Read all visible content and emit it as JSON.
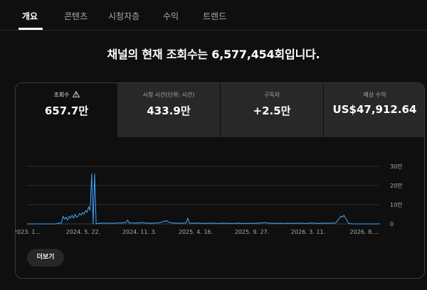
{
  "tabs": [
    {
      "label": "개요",
      "active": true
    },
    {
      "label": "콘텐츠",
      "active": false
    },
    {
      "label": "시청자층",
      "active": false
    },
    {
      "label": "수익",
      "active": false
    },
    {
      "label": "트렌드",
      "active": false
    }
  ],
  "headline": "채널의 현재 조회수는 6,577,454회입니다.",
  "metrics": [
    {
      "label": "조회수",
      "value": "657.7만",
      "icon": "warning-icon",
      "selected": true
    },
    {
      "label": "시청 시간(단위: 시간)",
      "value": "433.9만",
      "selected": false
    },
    {
      "label": "구독자",
      "value": "+2.5만",
      "selected": false
    },
    {
      "label": "예상 수익",
      "value": "US$47,912.64",
      "selected": false
    }
  ],
  "more_button": "더보기",
  "colors": {
    "line": "#3ea6ff",
    "selected_metric_bg": "#0f0f0f",
    "metric_bg": "#282828"
  },
  "chart_data": {
    "type": "line",
    "x_tick_labels": [
      "2023. 1...",
      "2024. 5. 22.",
      "2024. 11. 3.",
      "2025. 4. 16.",
      "2025. 9. 27.",
      "2026. 3. 11.",
      "2026. 8...."
    ],
    "y_tick_labels": [
      "30만",
      "20만",
      "10만",
      "0"
    ],
    "y_ticks": [
      300000,
      200000,
      100000,
      0
    ],
    "ylim": [
      0,
      300000
    ],
    "grid": true,
    "series": [
      {
        "values": [
          0,
          0,
          0,
          0,
          0,
          0,
          0,
          0,
          0,
          0,
          0,
          0,
          0,
          0,
          0,
          0,
          0,
          0,
          0,
          0,
          2000,
          4000,
          3000,
          6000,
          40000,
          25000,
          35000,
          20000,
          40000,
          30000,
          45000,
          30000,
          50000,
          35000,
          40000,
          55000,
          45000,
          60000,
          50000,
          70000,
          60000,
          90000,
          70000,
          260000,
          0,
          260000,
          0,
          3000,
          2000,
          4000,
          3000,
          5000,
          4000,
          3000,
          4000,
          5000,
          3000,
          4000,
          3000,
          5000,
          4000,
          5000,
          6000,
          5000,
          7000,
          6000,
          8000,
          20000,
          5000,
          6000,
          5000,
          4000,
          5000,
          4000,
          6000,
          5000,
          7000,
          6000,
          5000,
          4000,
          5000,
          4000,
          3000,
          4000,
          3000,
          5000,
          4000,
          5000,
          6000,
          8000,
          10000,
          15000,
          12000,
          18000,
          10000,
          8000,
          6000,
          5000,
          4000,
          5000,
          4000,
          3000,
          4000,
          3000,
          5000,
          4000,
          6000,
          30000,
          5000,
          4000,
          3000,
          4000,
          3000,
          4000,
          5000,
          4000,
          3000,
          4000,
          3000,
          2000,
          3000,
          4000,
          3000,
          4000,
          3000,
          4000,
          3000,
          2000,
          3000,
          4000,
          3000,
          4000,
          3000,
          4000,
          3000,
          2000,
          3000,
          2000,
          3000,
          4000,
          3000,
          4000,
          3000,
          2000,
          3000,
          2000,
          3000,
          4000,
          3000,
          2000,
          3000,
          4000,
          3000,
          4000,
          3000,
          4000,
          6000,
          5000,
          8000,
          6000,
          5000,
          4000,
          3000,
          4000,
          3000,
          2000,
          3000,
          4000,
          3000,
          4000,
          3000,
          2000,
          3000,
          4000,
          3000,
          4000,
          3000,
          2000,
          3000,
          4000,
          3000,
          4000,
          3000,
          4000,
          3000,
          2000,
          3000,
          4000,
          3000,
          4000,
          5000,
          3000,
          4000,
          3000,
          2000,
          3000,
          4000,
          3000,
          4000,
          3000,
          4000,
          3000,
          4000,
          5000,
          3000,
          4000,
          10000,
          20000,
          30000,
          40000,
          35000,
          45000,
          30000,
          20000,
          3000,
          2000,
          1000,
          0,
          0,
          0,
          0,
          0,
          0,
          0,
          0,
          0,
          0,
          0,
          0,
          0,
          0,
          0,
          0,
          0,
          0,
          0
        ]
      }
    ]
  }
}
